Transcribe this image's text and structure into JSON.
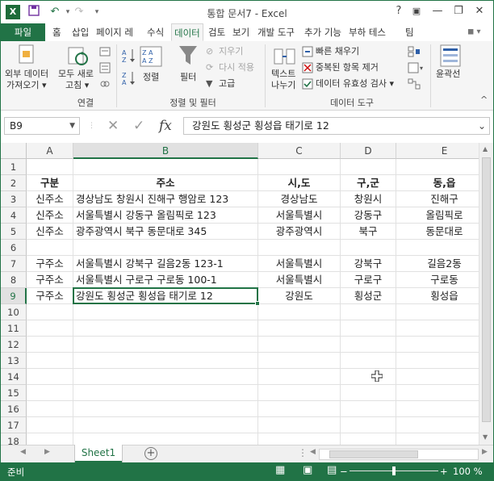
{
  "titlebar": {
    "logo": "X",
    "title": "통합 문서7 - Excel",
    "help": "?",
    "minimize": "—",
    "restore": "❐",
    "close": "✕",
    "undo": "↶",
    "redo": "↷",
    "qa_more": "▾"
  },
  "tabs": {
    "file": "파일",
    "items": [
      "홈",
      "삽입",
      "페이지 레",
      "수식",
      "데이터",
      "검토",
      "보기",
      "개발 도구",
      "추가 기능",
      "부하 테스",
      "팀"
    ],
    "active": "데이터",
    "user": "◼ ▾"
  },
  "ribbon": {
    "external_data": [
      "외부 데이터",
      "가져오기 ▾"
    ],
    "refresh_all": [
      "모두 새로",
      "고침 ▾"
    ],
    "group_connections": "연결",
    "sort": "정렬",
    "filter": "필터",
    "clear": "지우기",
    "reapply": "다시 적용",
    "advanced": "고급",
    "group_sort_filter": "정렬 및 필터",
    "text_to_columns": [
      "텍스트",
      "나누기"
    ],
    "flash_fill": "빠른 채우기",
    "remove_duplicates": "중복된 항목 제거",
    "data_validation": "데이터 유효성 검사 ▾",
    "group_data_tools": "데이터 도구",
    "outline": "윤곽선",
    "collapse": "^"
  },
  "formula_bar": {
    "name_box": "B9",
    "content": "강원도 횡성군 횡성읍 태기로 12",
    "cancel": "✕",
    "enter": "✓",
    "fx": "fx"
  },
  "grid": {
    "columns": [
      "A",
      "B",
      "C",
      "D",
      "E"
    ],
    "rows": [
      "1",
      "2",
      "3",
      "4",
      "5",
      "6",
      "7",
      "8",
      "9",
      "10",
      "11",
      "12",
      "13",
      "14",
      "15",
      "16",
      "17",
      "18"
    ],
    "selected_col": "B",
    "selected_row": "9",
    "cells": {
      "A2": "구분",
      "B2": "주소",
      "C2": "시,도",
      "D2": "구,군",
      "E2": "동,읍",
      "A3": "신주소",
      "B3": "경상남도 창원시 진해구 행암로 123",
      "C3": "경상남도",
      "D3": "창원시",
      "E3": "진해구",
      "A4": "신주소",
      "B4": "서울특별시 강동구 올림픽로 123",
      "C4": "서울특별시",
      "D4": "강동구",
      "E4": "올림픽로",
      "A5": "신주소",
      "B5": "광주광역시 북구 동문대로 345",
      "C5": "광주광역시",
      "D5": "북구",
      "E5": "동문대로",
      "A7": "구주소",
      "B7": "서울특별시 강북구 길음2동 123-1",
      "C7": "서울특별시",
      "D7": "강북구",
      "E7": "길음2동",
      "A8": "구주소",
      "B8": "서울특별시 구로구 구로동 100-1",
      "C8": "서울특별시",
      "D8": "구로구",
      "E8": "구로동",
      "A9": "구주소",
      "B9": "강원도 횡성군 횡성읍 태기로 12",
      "C9": "강원도",
      "D9": "횡성군",
      "E9": "횡성읍"
    }
  },
  "sheets": {
    "tabs": [
      "Sheet1"
    ],
    "add": "+",
    "prev": "◀",
    "next": "▶",
    "more": "⋮"
  },
  "status": {
    "ready": "준비",
    "zoom": "100 %",
    "zoom_minus": "−",
    "zoom_plus": "+",
    "zoom_level": 0.5,
    "view_normal": "▦",
    "view_layout": "▣",
    "view_break": "▤"
  },
  "colors": {
    "accent": "#217346",
    "ribbon_bg": "#f5f5f5",
    "header_bg": "#f3f3f3"
  }
}
